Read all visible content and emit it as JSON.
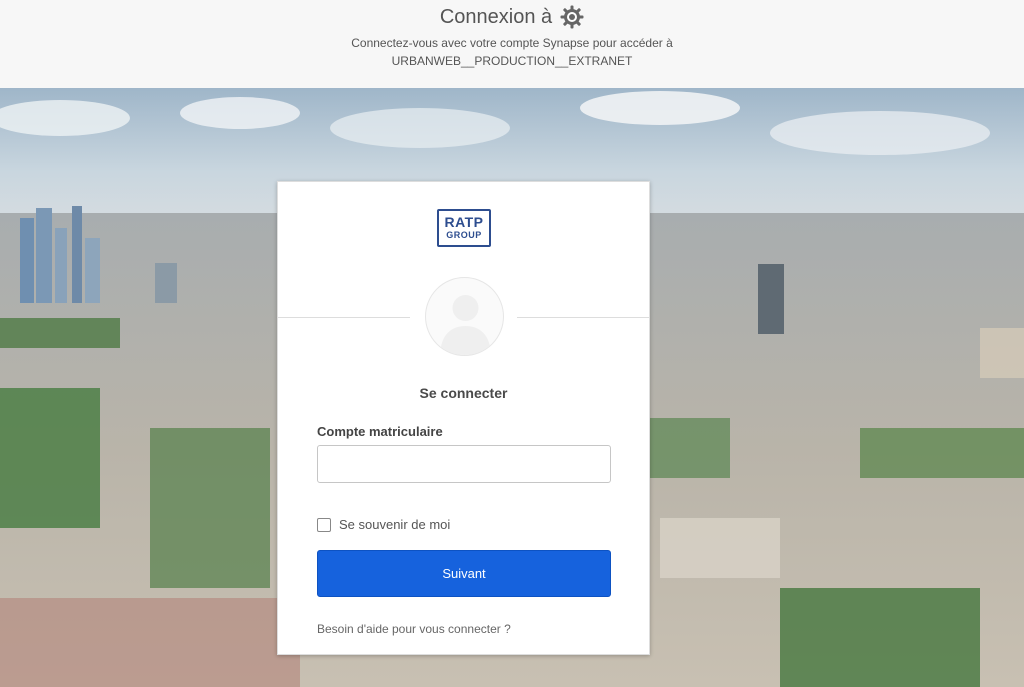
{
  "header": {
    "title": "Connexion à",
    "subtitle_line1": "Connectez-vous avec votre compte Synapse pour accéder à",
    "subtitle_line2": "URBANWEB__PRODUCTION__EXTRANET",
    "icon": "gear-icon"
  },
  "card": {
    "logo_line1": "RATP",
    "logo_line2": "GROUP",
    "heading": "Se connecter",
    "field_label": "Compte matriculaire",
    "field_value": "",
    "remember_label": "Se souvenir de moi",
    "remember_checked": false,
    "submit_label": "Suivant",
    "help_link": "Besoin d'aide pour vous connecter ?"
  },
  "colors": {
    "primary": "#1662dd",
    "logo": "#2d4d8f"
  }
}
